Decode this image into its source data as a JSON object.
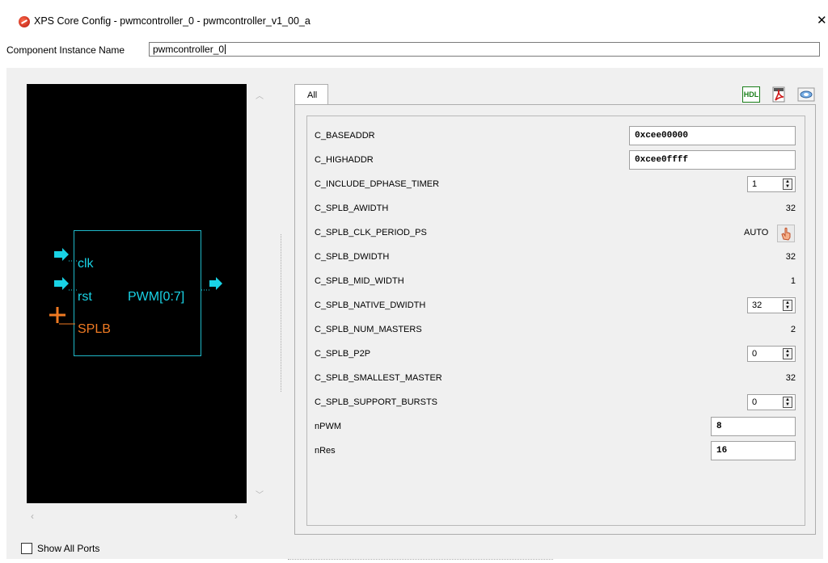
{
  "window": {
    "title": "XPS Core Config - pwmcontroller_0 - pwmcontroller_v1_00_a",
    "close": "✕"
  },
  "instance": {
    "label": "Component Instance Name",
    "value": "pwmcontroller_0"
  },
  "diagram": {
    "ports": {
      "clk": "clk",
      "rst": "rst",
      "bus": "SPLB",
      "pwm": "PWM[0:7]"
    }
  },
  "show_all_ports": {
    "label": "Show All Ports",
    "checked": false
  },
  "tabs": [
    "All"
  ],
  "toolbar": {
    "hdl": "HDL"
  },
  "params": [
    {
      "name": "C_BASEADDR",
      "kind": "input",
      "value": "0xcee00000"
    },
    {
      "name": "C_HIGHADDR",
      "kind": "input",
      "value": "0xcee0ffff"
    },
    {
      "name": "C_INCLUDE_DPHASE_TIMER",
      "kind": "spin",
      "value": "1"
    },
    {
      "name": "C_SPLB_AWIDTH",
      "kind": "text",
      "value": "32"
    },
    {
      "name": "C_SPLB_CLK_PERIOD_PS",
      "kind": "auto",
      "value": "AUTO"
    },
    {
      "name": "C_SPLB_DWIDTH",
      "kind": "text",
      "value": "32"
    },
    {
      "name": "C_SPLB_MID_WIDTH",
      "kind": "text",
      "value": "1"
    },
    {
      "name": "C_SPLB_NATIVE_DWIDTH",
      "kind": "spin",
      "value": "32"
    },
    {
      "name": "C_SPLB_NUM_MASTERS",
      "kind": "text",
      "value": "2"
    },
    {
      "name": "C_SPLB_P2P",
      "kind": "spin",
      "value": "0"
    },
    {
      "name": "C_SPLB_SMALLEST_MASTER",
      "kind": "text",
      "value": "32"
    },
    {
      "name": "C_SPLB_SUPPORT_BURSTS",
      "kind": "spin",
      "value": "0"
    },
    {
      "name": "nPWM",
      "kind": "input2",
      "value": "8"
    },
    {
      "name": "nRes",
      "kind": "input2",
      "value": "16"
    }
  ],
  "colors": {
    "diagram_bg": "#000000",
    "block_outline": "#1fb8c8",
    "port_cyan": "#19d3e6",
    "bus_orange": "#f07a22"
  }
}
